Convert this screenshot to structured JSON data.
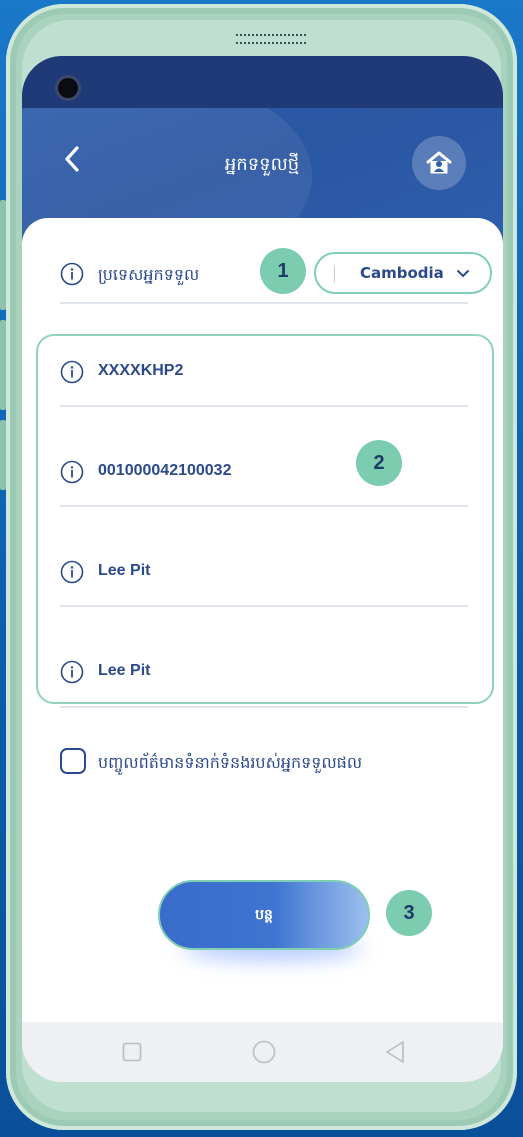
{
  "screen": {
    "title": "អ្នកទទួលថ្មី",
    "back_icon": "chevron-left-icon",
    "home_icon": "home-icon"
  },
  "country": {
    "label": "ប្រទេសអ្នកទទួល",
    "value": "Cambodia"
  },
  "fields": [
    {
      "value": "XXXXKHP2"
    },
    {
      "value": "001000042100032"
    },
    {
      "value": "Lee Pit"
    },
    {
      "value": "Lee Pit"
    }
  ],
  "checkbox": {
    "label": "បញ្ចូលព័ត៌មានទំនាក់ទំនងរបស់អ្នកទទួលផល",
    "checked": false
  },
  "continue_button": {
    "label": "បន្ត"
  },
  "badges": [
    "1",
    "2",
    "3"
  ],
  "colors": {
    "primary": "#2b4a8b",
    "header": "#2e5fab",
    "accent": "#7ccdb0"
  }
}
